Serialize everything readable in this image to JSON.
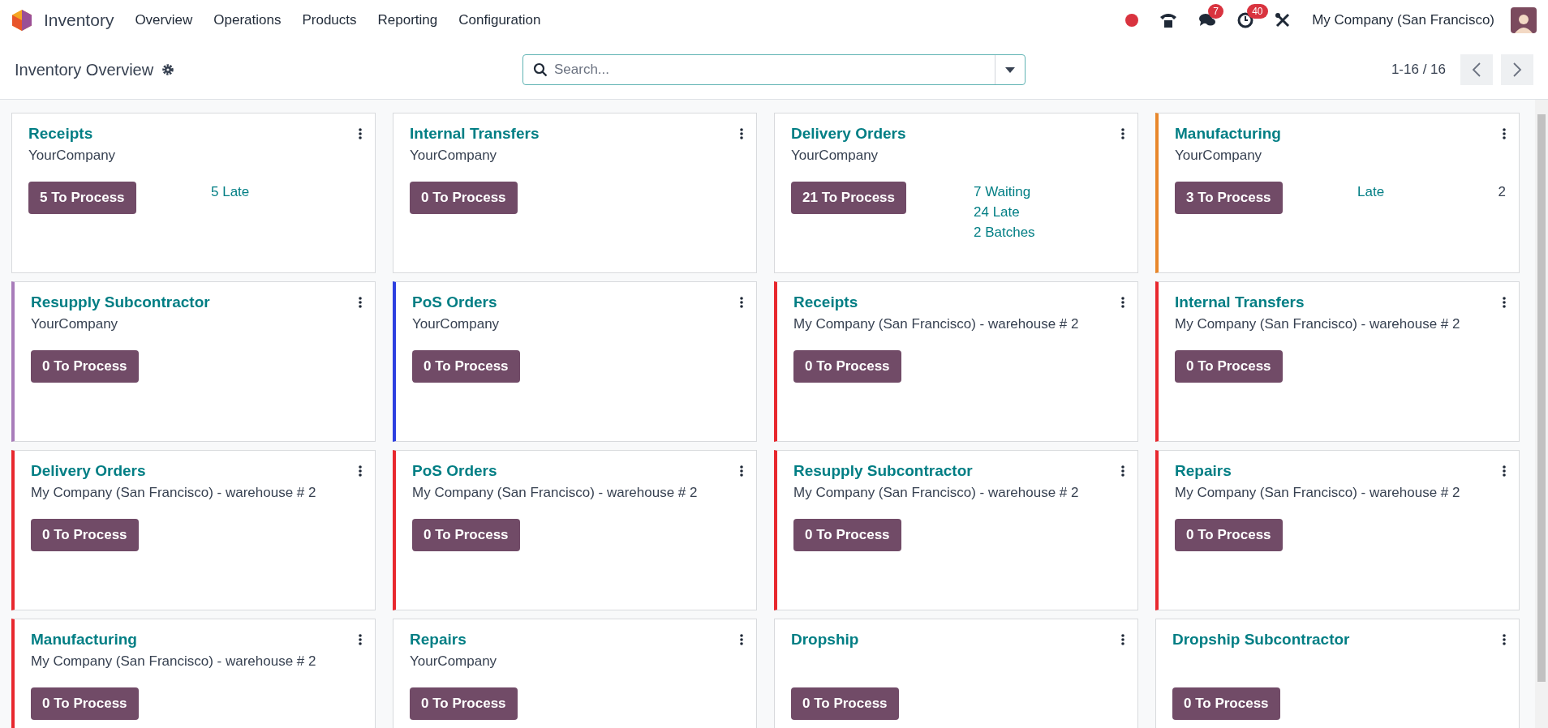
{
  "navbar": {
    "app_name": "Inventory",
    "menu": [
      "Overview",
      "Operations",
      "Products",
      "Reporting",
      "Configuration"
    ],
    "systray": [
      {
        "kind": "dot"
      },
      {
        "kind": "phone"
      },
      {
        "kind": "chat",
        "badge": "7"
      },
      {
        "kind": "clock",
        "badge": "40"
      },
      {
        "kind": "tools"
      }
    ],
    "company": "My Company (San Francisco)"
  },
  "control_panel": {
    "title": "Inventory Overview",
    "search": {
      "placeholder": "Search..."
    },
    "pager": "1-16 / 16"
  },
  "cards": [
    {
      "title": "Receipts",
      "company": "YourCompany",
      "button": "5 To Process",
      "stats": [
        {
          "label": "5 Late"
        }
      ]
    },
    {
      "title": "Internal Transfers",
      "company": "YourCompany",
      "button": "0 To Process"
    },
    {
      "title": "Delivery Orders",
      "company": "YourCompany",
      "button": "21 To Process",
      "stats": [
        {
          "label": "7 Waiting"
        },
        {
          "label": "24 Late"
        },
        {
          "label": "2 Batches"
        }
      ]
    },
    {
      "title": "Manufacturing",
      "company": "YourCompany",
      "button": "3 To Process",
      "color": "#e8872b",
      "stats": [
        {
          "label": "Late",
          "value": "2"
        }
      ]
    },
    {
      "title": "Resupply Subcontractor",
      "company": "YourCompany",
      "button": "0 To Process",
      "color": "#a87cba"
    },
    {
      "title": "PoS Orders",
      "company": "YourCompany",
      "button": "0 To Process",
      "color": "#2c3fe0"
    },
    {
      "title": "Receipts",
      "company": "My Company (San Francisco) - warehouse # 2",
      "button": "0 To Process",
      "color": "#e8282e"
    },
    {
      "title": "Internal Transfers",
      "company": "My Company (San Francisco) - warehouse # 2",
      "button": "0 To Process",
      "color": "#e8282e"
    },
    {
      "title": "Delivery Orders",
      "company": "My Company (San Francisco) - warehouse # 2",
      "button": "0 To Process",
      "color": "#e8282e"
    },
    {
      "title": "PoS Orders",
      "company": "My Company (San Francisco) - warehouse # 2",
      "button": "0 To Process",
      "color": "#e8282e"
    },
    {
      "title": "Resupply Subcontractor",
      "company": "My Company (San Francisco) - warehouse # 2",
      "button": "0 To Process",
      "color": "#e8282e"
    },
    {
      "title": "Repairs",
      "company": "My Company (San Francisco) - warehouse # 2",
      "button": "0 To Process",
      "color": "#e8282e"
    },
    {
      "title": "Manufacturing",
      "company": "My Company (San Francisco) - warehouse # 2",
      "button": "0 To Process",
      "color": "#e8282e"
    },
    {
      "title": "Repairs",
      "company": "YourCompany",
      "button": "0 To Process"
    },
    {
      "title": "Dropship",
      "button": "0 To Process"
    },
    {
      "title": "Dropship Subcontractor",
      "button": "0 To Process"
    }
  ]
}
